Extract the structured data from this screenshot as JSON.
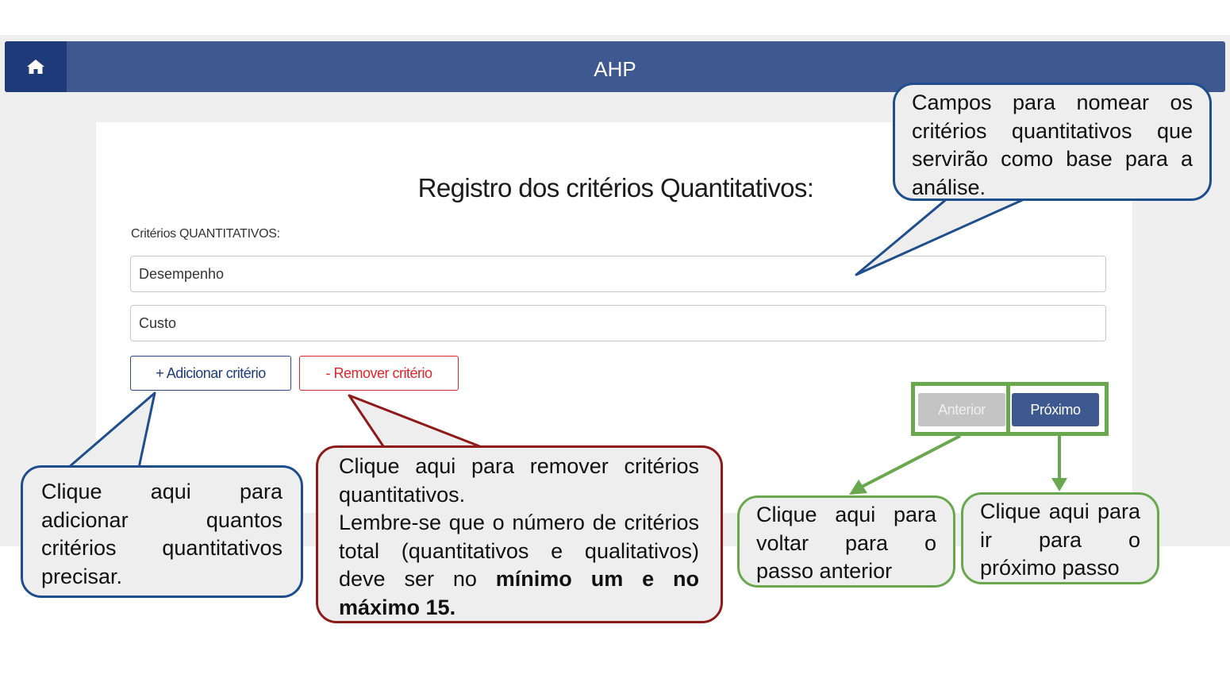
{
  "navbar": {
    "title": "AHP",
    "home_icon": "home-icon",
    "bg_color": "#3e5890",
    "home_bg_color": "#1e3a78"
  },
  "form": {
    "title": "Registro dos critérios Quantitativos:",
    "criteria_label": "Critérios QUANTITATIVOS:",
    "criteria": [
      {
        "value": "Desempenho"
      },
      {
        "value": "Custo"
      }
    ],
    "add_button": "+ Adicionar critério",
    "remove_button": "- Remover critério",
    "prev_button": "Anterior",
    "next_button": "Próximo"
  },
  "callouts": {
    "fields": "Campos para nomear os critérios quantitativos que servirão como base para a análise.",
    "add": "Clique aqui para adicionar quantos critérios quantitativos precisar.",
    "remove_line1": "Clique aqui para remover critérios quantitativos.",
    "remove_line2": "Lembre-se que o número de critérios total (quantitativos e qualitativos) deve ser no",
    "remove_bold": "mínimo um e no máximo 15.",
    "prev": "Clique aqui para voltar para o passo anterior",
    "next": "Clique aqui para ir para o próximo passo"
  },
  "colors": {
    "blue_callout": "#1f4e8c",
    "red_callout": "#8e1a1a",
    "green_callout": "#6aa84f"
  }
}
